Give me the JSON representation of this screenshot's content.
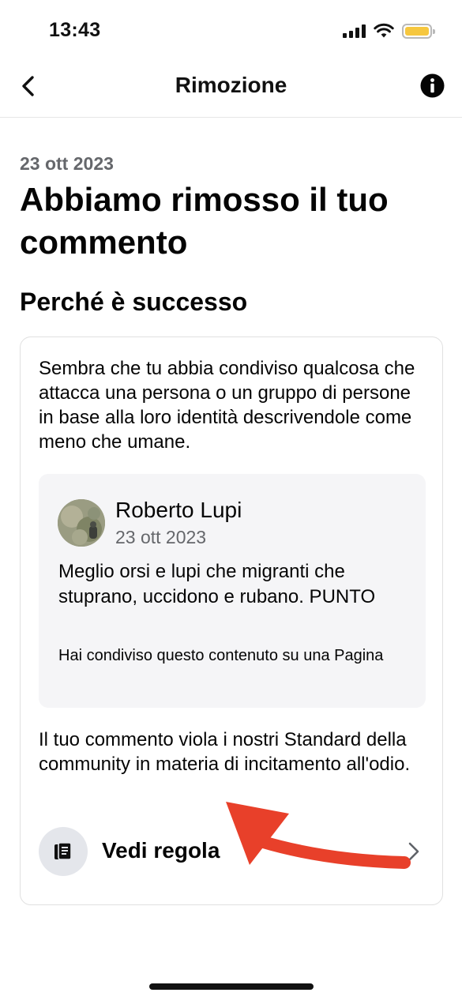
{
  "status_bar": {
    "time": "13:43",
    "signal_icon": "cellular-signal-icon",
    "wifi_icon": "wifi-icon",
    "battery_icon": "battery-icon",
    "battery_color": "#f6c73f"
  },
  "nav": {
    "title": "Rimozione",
    "back_icon": "chevron-left-icon",
    "info_icon": "info-icon"
  },
  "main": {
    "date": "23 ott 2023",
    "headline": "Abbiamo rimosso il tuo commento",
    "section_title": "Perché è successo",
    "card": {
      "explanation": "Sembra che tu abbia condiviso qualcosa che attacca una persona o un gruppo di persone in base alla loro identità descrivendole come meno che umane.",
      "quote": {
        "author": "Roberto Lupi",
        "date": "23 ott 2023",
        "comment": "Meglio orsi e lupi che migranti che stuprano, uccidono e rubano. PUNTO",
        "share_note": "Hai condiviso questo contenuto su una Pagina"
      },
      "violation": "Il tuo commento viola i nostri Standard della community in materia di incitamento all'odio.",
      "rule_link": {
        "label": "Vedi regola",
        "icon": "rulebook-icon",
        "chevron_icon": "chevron-right-icon"
      }
    }
  },
  "annotation": {
    "arrow_color": "#e8402a"
  }
}
